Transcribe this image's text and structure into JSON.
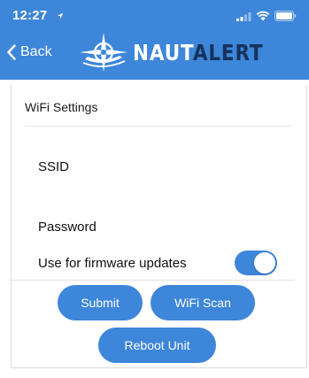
{
  "status_bar": {
    "time": "12:27"
  },
  "nav": {
    "back_label": "Back",
    "logo_part1": "NAUT",
    "logo_part2": "ALERT"
  },
  "settings": {
    "section_title": "WiFi Settings",
    "ssid_label": "SSID",
    "password_label": "Password",
    "firmware_label": "Use for firmware updates",
    "firmware_toggle_on": true
  },
  "buttons": {
    "submit": "Submit",
    "wifi_scan": "WiFi Scan",
    "reboot": "Reboot Unit"
  },
  "colors": {
    "accent": "#3d86d9",
    "logo_dark": "#15325c"
  }
}
